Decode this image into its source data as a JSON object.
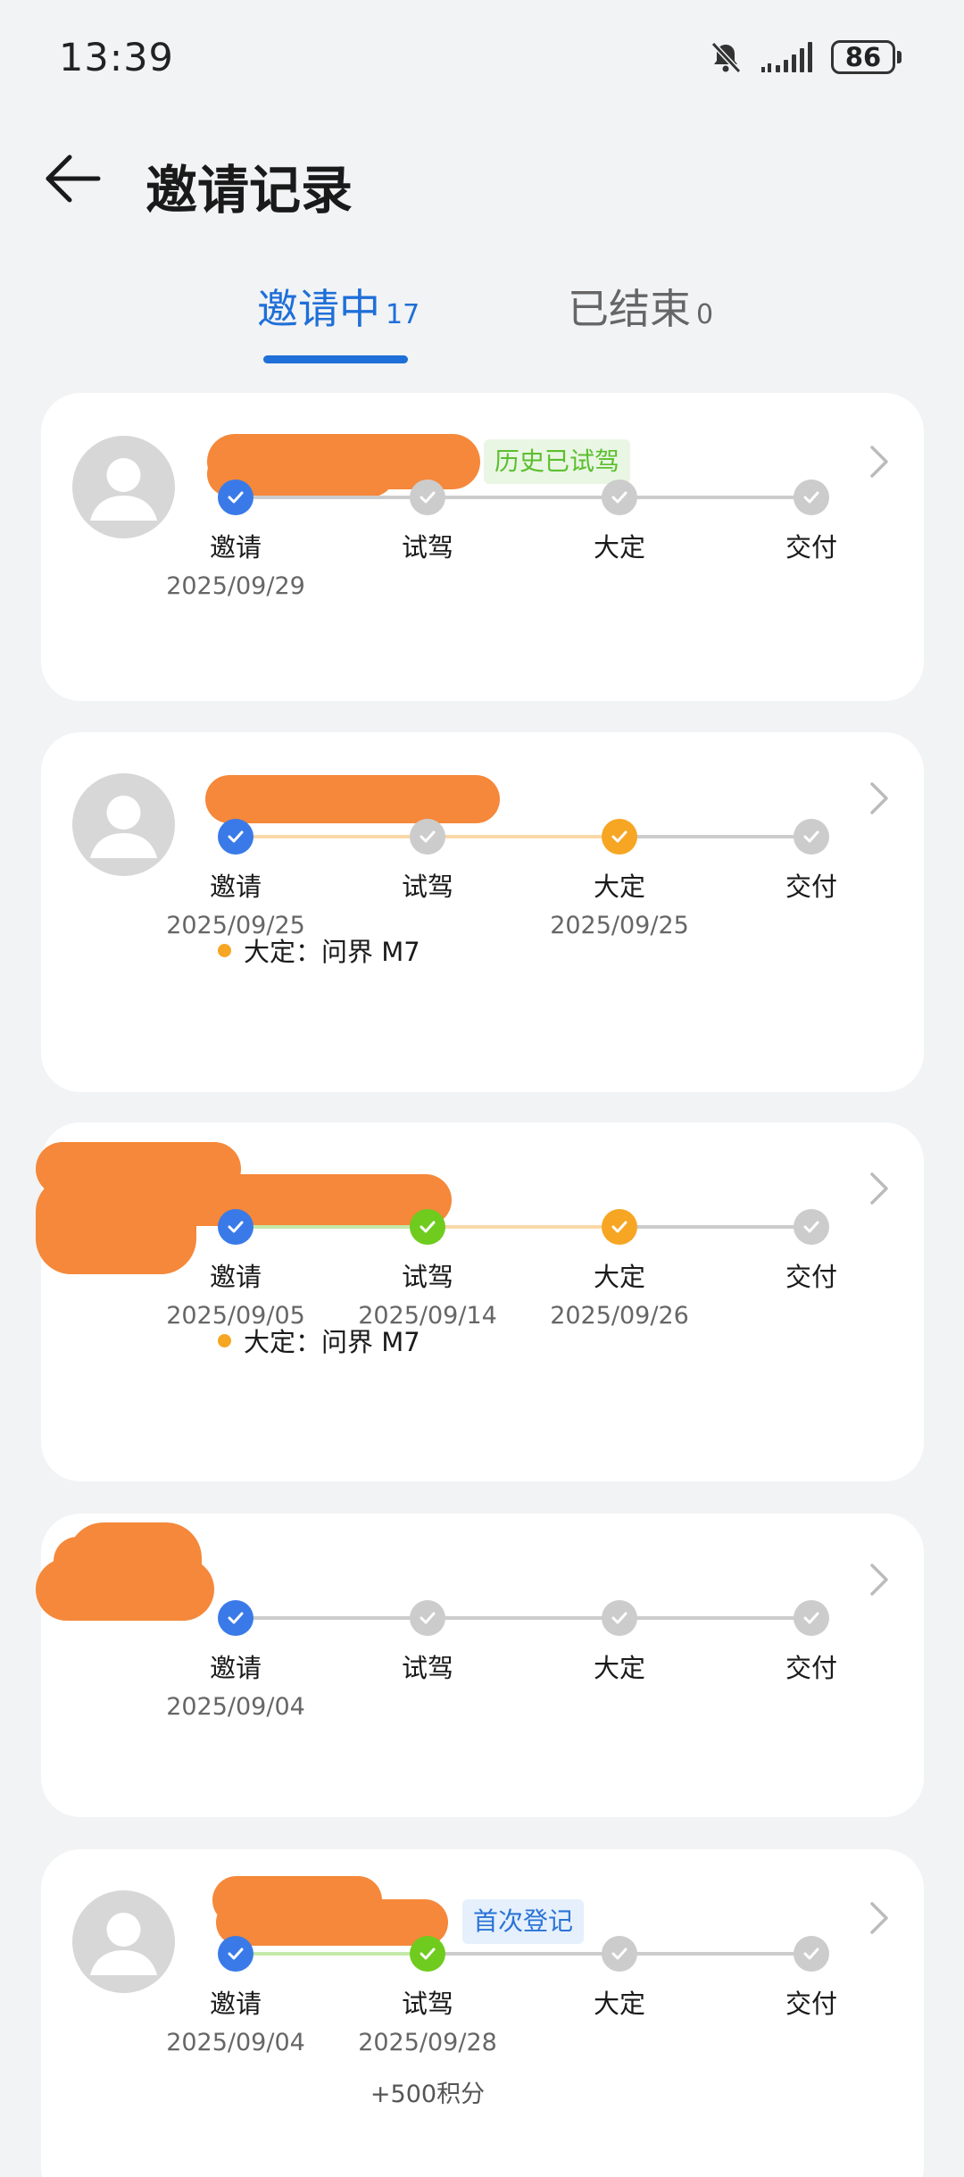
{
  "status_bar": {
    "time": "13:39",
    "battery": "86"
  },
  "header": {
    "title": "邀请记录"
  },
  "tabs": [
    {
      "label": "邀请中",
      "count": "17"
    },
    {
      "label": "已结束",
      "count": "0"
    }
  ],
  "steps": [
    "邀请",
    "试驾",
    "大定",
    "交付"
  ],
  "colors": {
    "blue": "#3a7ae8",
    "green": "#6fcb1e",
    "orange": "#f6a623",
    "gray": "#cccccc"
  },
  "cards": [
    {
      "tag": "历史已试驾",
      "dates": [
        "2025/09/29",
        "",
        "",
        ""
      ]
    },
    {
      "dates": [
        "2025/09/25",
        "",
        "2025/09/25",
        ""
      ],
      "deposit": "大定：问界 M7"
    },
    {
      "dates": [
        "2025/09/05",
        "2025/09/14",
        "2025/09/26",
        ""
      ],
      "deposit": "大定：问界 M7"
    },
    {
      "dates": [
        "2025/09/04",
        "",
        "",
        ""
      ]
    },
    {
      "tag": "首次登记",
      "dates": [
        "2025/09/04",
        "2025/09/28",
        "",
        ""
      ],
      "points": "+500积分"
    }
  ]
}
